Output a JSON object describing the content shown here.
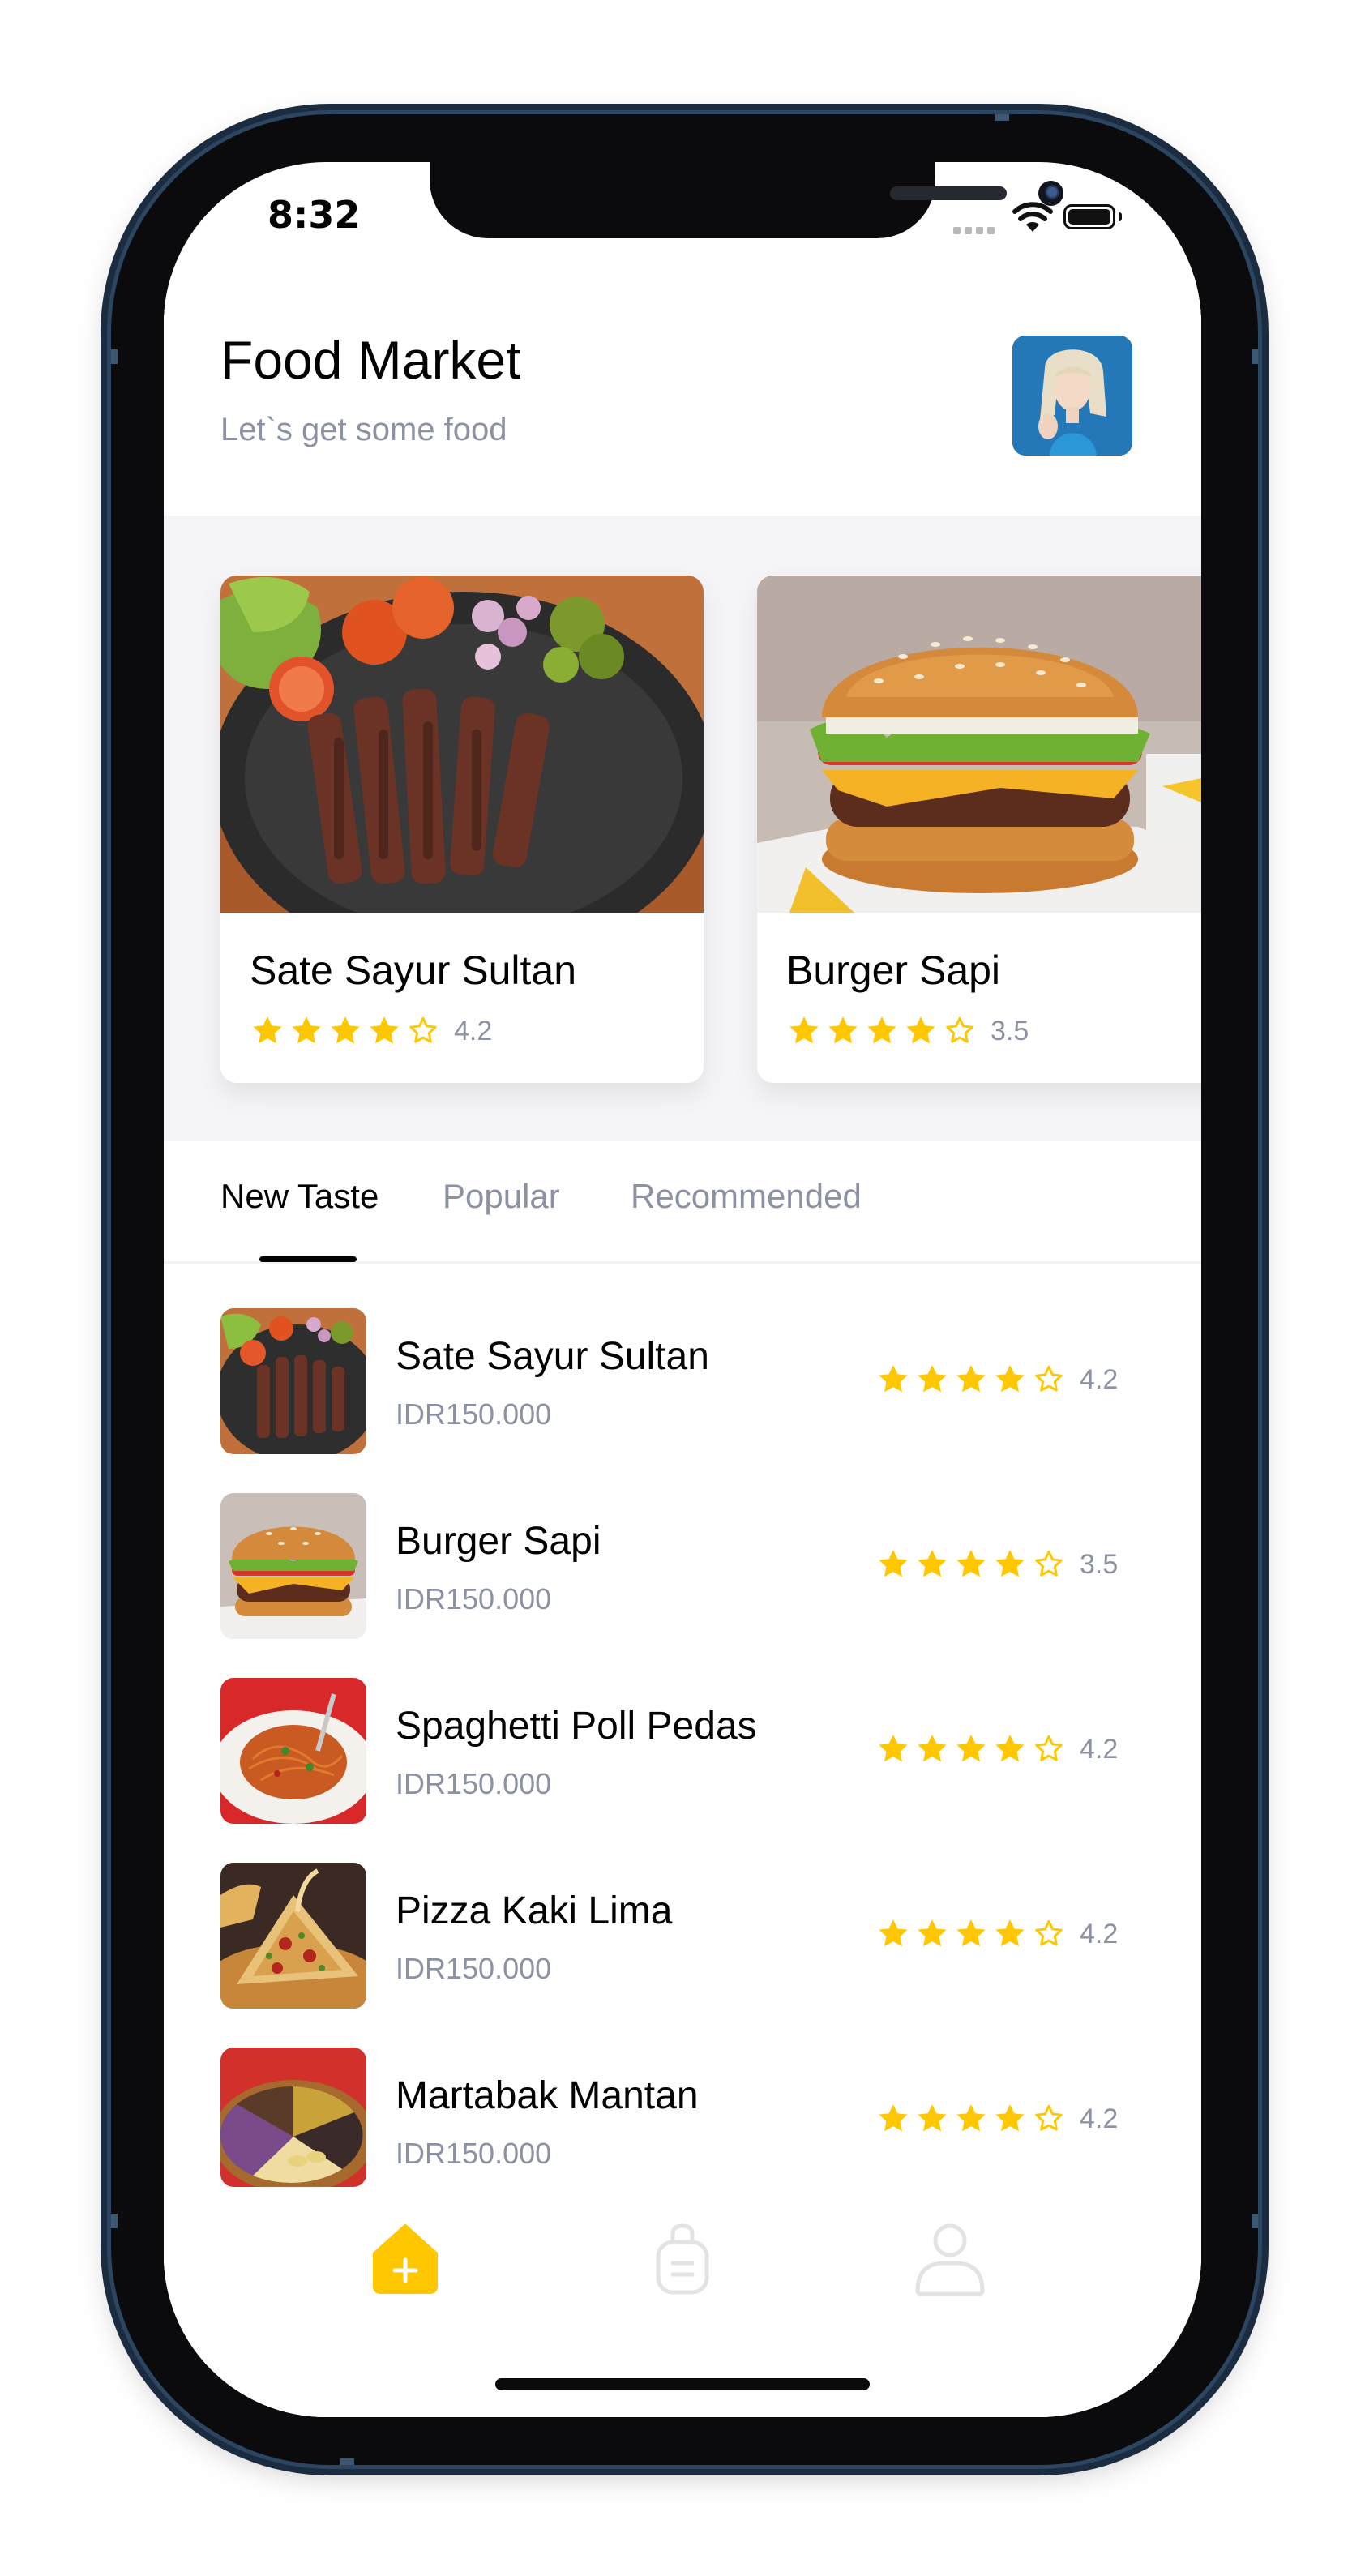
{
  "status_bar": {
    "time": "8:32"
  },
  "header": {
    "title": "Food Market",
    "subtitle": "Let`s get some food",
    "avatar_icon": "profile-avatar"
  },
  "featured": [
    {
      "name": "Sate Sayur Sultan",
      "rating": 4.2,
      "rating_label": "4.2",
      "stars_filled": 4
    },
    {
      "name": "Burger Sapi",
      "rating": 3.5,
      "rating_label": "3.5",
      "stars_filled": 4
    }
  ],
  "tabs": [
    {
      "label": "New Taste",
      "active": true
    },
    {
      "label": "Popular",
      "active": false
    },
    {
      "label": "Recommended",
      "active": false
    }
  ],
  "foods": [
    {
      "name": "Sate Sayur Sultan",
      "price": "IDR150.000",
      "rating_label": "4.2",
      "stars_filled": 4
    },
    {
      "name": "Burger Sapi",
      "price": "IDR150.000",
      "rating_label": "3.5",
      "stars_filled": 4
    },
    {
      "name": "Spaghetti Poll Pedas",
      "price": "IDR150.000",
      "rating_label": "4.2",
      "stars_filled": 4
    },
    {
      "name": "Pizza Kaki Lima",
      "price": "IDR150.000",
      "rating_label": "4.2",
      "stars_filled": 4
    },
    {
      "name": "Martabak Mantan",
      "price": "IDR150.000",
      "rating_label": "4.2",
      "stars_filled": 4
    }
  ],
  "bottom_nav": [
    {
      "icon": "home-icon",
      "active": true
    },
    {
      "icon": "order-bag-icon",
      "active": false
    },
    {
      "icon": "profile-icon",
      "active": false
    }
  ],
  "colors": {
    "accent": "#FFC700",
    "text_primary": "#020202",
    "text_secondary": "#8D92A3",
    "inactive_icon": "#E3E3E3"
  }
}
